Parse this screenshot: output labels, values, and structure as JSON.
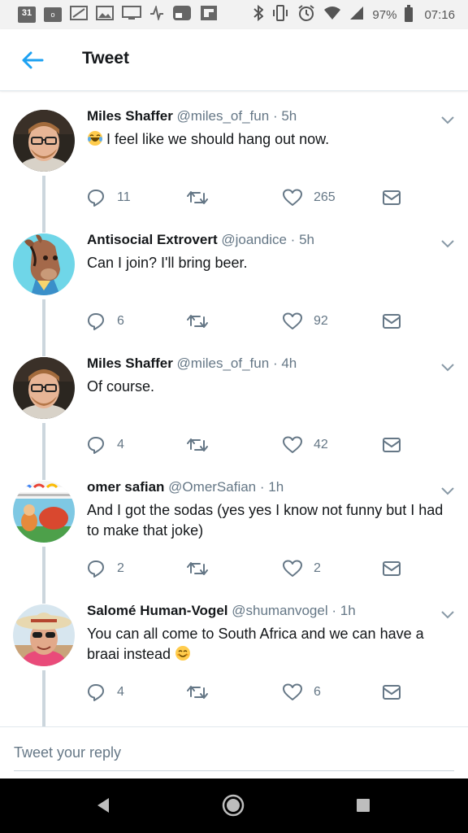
{
  "status_bar": {
    "calendar_day": "31",
    "battery_percent": "97%",
    "time": "07:16",
    "icons": [
      "calendar-icon",
      "overflow-icon",
      "signal-icon",
      "image-icon",
      "cast-icon",
      "fitness-icon",
      "gallery-icon",
      "flipboard-icon",
      "bluetooth-icon",
      "vibrate-icon",
      "alarm-icon",
      "wifi-icon",
      "cell-signal-icon",
      "battery-icon"
    ]
  },
  "header": {
    "title": "Tweet",
    "back_icon": "arrow-left-icon"
  },
  "tweets": [
    {
      "name": "Miles Shaffer",
      "handle": "@miles_of_fun",
      "time": "5h",
      "emoji": "😂",
      "text": "I feel like we should hang out now.",
      "replies": "11",
      "retweets": "",
      "likes": "265"
    },
    {
      "name": "Antisocial Extrovert",
      "handle": "@joandice",
      "time": "5h",
      "emoji": "",
      "text": "Can I join? I'll bring beer.",
      "replies": "6",
      "retweets": "",
      "likes": "92"
    },
    {
      "name": "Miles Shaffer",
      "handle": "@miles_of_fun",
      "time": "4h",
      "emoji": "",
      "text": "Of course.",
      "replies": "4",
      "retweets": "",
      "likes": "42"
    },
    {
      "name": "omer safian",
      "handle": "@OmerSafian",
      "time": "1h",
      "emoji": "",
      "text": "And I got the sodas (yes yes I know not funny but I had to make that joke)",
      "replies": "2",
      "retweets": "",
      "likes": "2"
    },
    {
      "name": "Salomé Human-Vogel",
      "handle": "@shumanvogel",
      "time": "1h",
      "emoji": "",
      "text": "You can all come to South Africa and we can have a braai instead",
      "trailing_emoji": "😊",
      "replies": "4",
      "retweets": "",
      "likes": "6"
    }
  ],
  "separator": "·",
  "reply_bar": {
    "placeholder": "Tweet your reply"
  },
  "colors": {
    "accent": "#1da1f2",
    "text": "#14171a",
    "muted": "#657786",
    "thread_line": "#ccd6dd"
  }
}
